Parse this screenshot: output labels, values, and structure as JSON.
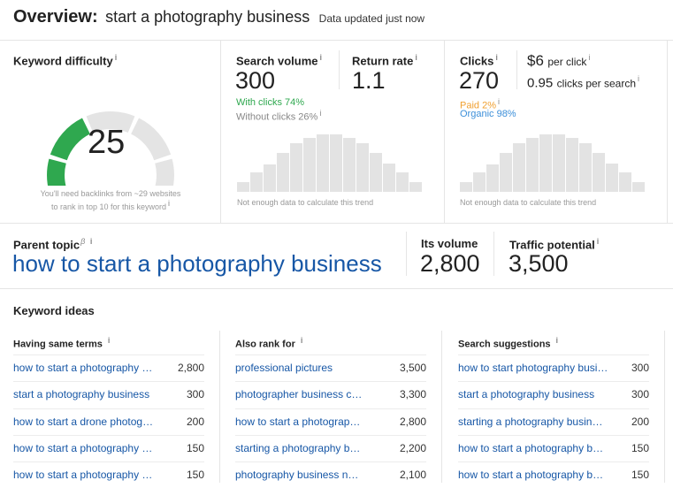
{
  "header": {
    "prefix": "Overview:",
    "keyword": "start a photography business",
    "status": "Data updated just now"
  },
  "difficulty": {
    "label": "Keyword difficulty",
    "value": "25",
    "note_line1": "You'll need backlinks from ~29 websites",
    "note_line2": "to rank in top 10 for this keyword"
  },
  "search_volume": {
    "label": "Search volume",
    "value": "300",
    "with_clicks": "With clicks 74%",
    "without_clicks": "Without clicks 26%",
    "note": "Not enough data to calculate this trend"
  },
  "return_rate": {
    "label": "Return rate",
    "value": "1.1"
  },
  "clicks": {
    "label": "Clicks",
    "value": "270",
    "paid": "Paid 2%",
    "organic": "Organic 98%",
    "note": "Not enough data to calculate this trend"
  },
  "cpc": {
    "value": "$6",
    "unit": "per click",
    "cps_value": "0.95",
    "cps_unit": "clicks per search"
  },
  "parent_topic": {
    "label": "Parent topic",
    "beta": "β",
    "value": "how to start a photography business",
    "its_volume_label": "Its volume",
    "its_volume": "2,800",
    "traffic_label": "Traffic potential",
    "traffic": "3,500"
  },
  "ideas": {
    "title": "Keyword ideas",
    "columns": [
      {
        "title": "Having same terms",
        "rows": [
          {
            "k": "how to start a photography …",
            "v": "2,800"
          },
          {
            "k": "start a photography business",
            "v": "300"
          },
          {
            "k": "how to start a drone photog…",
            "v": "200"
          },
          {
            "k": "how to start a photography …",
            "v": "150"
          },
          {
            "k": "how to start a photography …",
            "v": "150"
          }
        ]
      },
      {
        "title": "Also rank for",
        "rows": [
          {
            "k": "professional pictures",
            "v": "3,500"
          },
          {
            "k": "photographer business c…",
            "v": "3,300"
          },
          {
            "k": "how to start a photograp…",
            "v": "2,800"
          },
          {
            "k": "starting a photography b…",
            "v": "2,200"
          },
          {
            "k": "photography business n…",
            "v": "2,100"
          }
        ]
      },
      {
        "title": "Search suggestions",
        "rows": [
          {
            "k": "how to start photography busi…",
            "v": "300"
          },
          {
            "k": "start a photography business",
            "v": "300"
          },
          {
            "k": "starting a photography busine…",
            "v": "200"
          },
          {
            "k": "how to start a photography b…",
            "v": "150"
          },
          {
            "k": "how to start a photography b…",
            "v": "150"
          }
        ]
      }
    ]
  },
  "colors": {
    "green": "#2fa84f",
    "orange": "#f0a030",
    "blue": "#3c8fd9",
    "link": "#1757a6"
  },
  "info_icon": "i"
}
